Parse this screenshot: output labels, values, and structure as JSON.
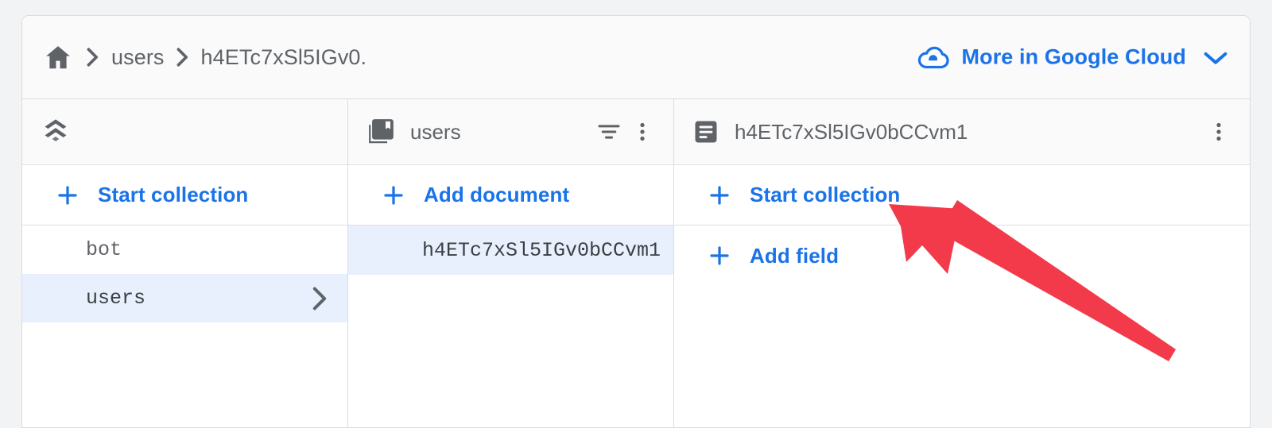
{
  "breadcrumb": {
    "home_icon": "home-icon",
    "separator_icon": "chevron-right-icon",
    "items": [
      "users",
      "h4ETc7xSl5IGv0."
    ]
  },
  "cloud_link": {
    "icon": "cloud-icon",
    "label": "More in Google Cloud",
    "chevron_icon": "chevron-down-icon",
    "color": "#1a73e8"
  },
  "columns": {
    "database": {
      "header": {
        "icon": "firestore-database-icon",
        "title": ""
      },
      "action": {
        "icon": "plus-icon",
        "label": "Start collection"
      },
      "items": [
        {
          "name": "bot",
          "selected": false
        },
        {
          "name": "users",
          "selected": true,
          "chevron_icon": "chevron-right-icon"
        }
      ]
    },
    "collection": {
      "header": {
        "icon": "collections-bookmark-icon",
        "title": "users",
        "filter_icon": "filter-icon",
        "menu_icon": "more-vert-icon"
      },
      "action": {
        "icon": "plus-icon",
        "label": "Add document"
      },
      "items": [
        {
          "name": "h4ETc7xSl5IGv0bCCvm1",
          "selected": true
        }
      ]
    },
    "document": {
      "header": {
        "icon": "document-icon",
        "title": "h4ETc7xSl5IGv0bCCvm1",
        "menu_icon": "more-vert-icon"
      },
      "actions": [
        {
          "icon": "plus-icon",
          "label": "Start collection"
        },
        {
          "icon": "plus-icon",
          "label": "Add field"
        }
      ]
    }
  },
  "annotation": {
    "type": "arrow",
    "color": "#f23a4a",
    "points_at": "Start collection"
  },
  "colors": {
    "accent_blue": "#1a73e8",
    "selected_row": "#e8f0fe",
    "text_gray": "#5f6368",
    "border": "#dadce0",
    "page_bg": "#f1f3f4"
  }
}
